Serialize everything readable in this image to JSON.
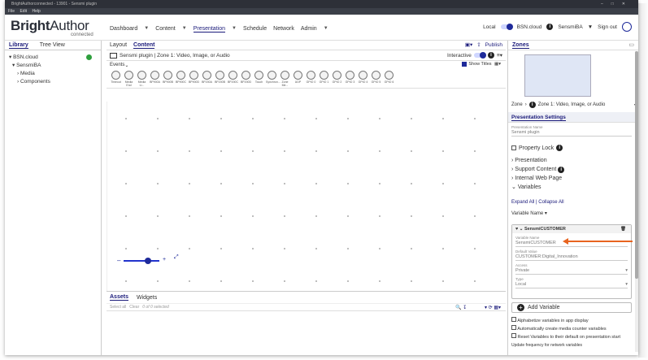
{
  "window": {
    "title": "BrightAuthorconnected - 13901 - Sensmi plugin"
  },
  "menu": [
    "File",
    "Edit",
    "Help"
  ],
  "brand": {
    "name_bold": "Bright",
    "name_light": "Author",
    "sub": "connected"
  },
  "nav": {
    "dashboard": "Dashboard",
    "content": "Content",
    "presentation": "Presentation",
    "schedule": "Schedule",
    "network": "Network",
    "admin": "Admin"
  },
  "header_right": {
    "local": "Local",
    "cloud": "BSN.cloud",
    "user": "SensmiBA",
    "signout": "Sign out"
  },
  "left": {
    "tabs": [
      "Library",
      "Tree View"
    ],
    "tree": {
      "root": "BSN.cloud",
      "child": "SensmiBA",
      "media": "Media",
      "components": "Components"
    }
  },
  "center": {
    "tabs": [
      "Layout",
      "Content"
    ],
    "publish": "Publish",
    "zone_title": "Sensmi plugin | Zone 1: Video, Image, or Audio",
    "interactive": "Interactive",
    "events": "Events",
    "show_titles": "Show Titles",
    "tools": [
      "Timeout",
      "Media End",
      "Media Li...",
      "BP900A",
      "BP900B",
      "BP900C",
      "BP900D",
      "BP200A",
      "BP200B",
      "BP200C",
      "BP200D",
      "Touch",
      "Synchron...",
      "Zone Me...",
      "UDP",
      "GPIO 0",
      "GPIO 1",
      "GPIO 2",
      "GPIO 3",
      "GPIO 4",
      "GPIO 5",
      "GPIO 6"
    ],
    "assets_tabs": [
      "Assets",
      "Widgets"
    ],
    "assets_bar": {
      "select_all": "Select all",
      "clear": "Clear",
      "count": "0 of 0 selected"
    }
  },
  "right": {
    "zones_title": "Zones",
    "zone_select": "Zone 1: Video, Image, or Audio",
    "zone_prefix": "Zone",
    "settings_title": "Presentation Settings",
    "presentation_name_label": "Presentation Name",
    "presentation_name": "Sensmi plugin",
    "property_lock": "Property Lock",
    "sections": [
      "Presentation",
      "Support Content",
      "Internal Web Page",
      "Variables"
    ],
    "expand_all": "Expand All",
    "collapse_all": "Collapse All",
    "variable_name_header": "Variable Name",
    "variable": {
      "header": "SensmiCUSTOMER",
      "name_label": "Variable Name",
      "name_value": "SensmiCUSTOMER",
      "default_label": "Default Value",
      "default_value": "CUSTOMER:Digital_Innovation",
      "access_label": "Access",
      "access_value": "Private",
      "type_label": "Type",
      "type_value": "Local"
    },
    "add_variable": "Add Variable",
    "options": [
      "Alphabetize variables in app display",
      "Automatically create media counter variables",
      "Reset Variables to their default on presentation start",
      "Update frequency for network variables"
    ]
  },
  "colors": {
    "accent": "#1a1a7a",
    "annotation_arrow": "#e8641f",
    "title_bar": "#2d3038"
  }
}
